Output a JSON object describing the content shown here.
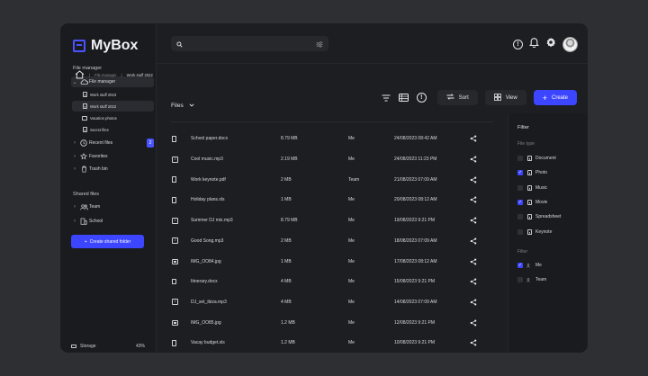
{
  "app": {
    "name": "MyBox"
  },
  "sidebar": {
    "file_manager_title": "File manager",
    "file_manager_label": "File manager",
    "sub_items": [
      {
        "label": "Work stuff 2023"
      },
      {
        "label": "Work stuff 2022"
      },
      {
        "label": "Vacation photos"
      },
      {
        "label": "Secret files"
      }
    ],
    "recent_files_label": "Recent files",
    "recent_files_count": "2",
    "favorites_label": "Favorites",
    "trash_label": "Trash bin",
    "shared_title": "Shared files",
    "shared_items": [
      {
        "label": "Team"
      },
      {
        "label": "School"
      }
    ],
    "create_shared_label": "Create shared folder",
    "storage_label": "Storage",
    "storage_pct": "43%"
  },
  "search": {
    "placeholder": ""
  },
  "breadcrumb": {
    "parent": "File manager",
    "current": "Work stuff 2022"
  },
  "files_heading": "Files",
  "toolbar": {
    "sort_label": "Sort",
    "view_label": "View",
    "create_label": "Create"
  },
  "files": [
    {
      "icon": "doc",
      "name": "School paper.docx",
      "size": "8.79 MB",
      "owner": "Me",
      "date": "24/08/2023 08:42 AM"
    },
    {
      "icon": "music",
      "name": "Cool music.mp3",
      "size": "2.19 MB",
      "owner": "Me",
      "date": "24/08/2023 11:23 PM"
    },
    {
      "icon": "doc",
      "name": "Work keynote.pdf",
      "size": "2 MB",
      "owner": "Team",
      "date": "21/08/2023 07:09 AM"
    },
    {
      "icon": "doc",
      "name": "Holiday plans.xls",
      "size": "1 MB",
      "owner": "Me",
      "date": "20/08/2023 08:12 AM"
    },
    {
      "icon": "music",
      "name": "Summer DJ mix.mp3",
      "size": "8.79 MB",
      "owner": "Me",
      "date": "19/08/2023 9:21 PM"
    },
    {
      "icon": "music",
      "name": "Good Song.mp3",
      "size": "2 MB",
      "owner": "Me",
      "date": "18/08/2023 07:09 AM"
    },
    {
      "icon": "photo",
      "name": "IMG_OO84.jpg",
      "size": "1 MB",
      "owner": "Me",
      "date": "17/08/2023 08:12 AM"
    },
    {
      "icon": "doc",
      "name": "Itinerary.docx",
      "size": "4 MB",
      "owner": "Me",
      "date": "15/08/2023 9:21 PM"
    },
    {
      "icon": "music",
      "name": "DJ_set_ibiza.mp3",
      "size": "4 MB",
      "owner": "Me",
      "date": "14/08/2023 07:09 AM"
    },
    {
      "icon": "photo",
      "name": "IMG_OO85.jpg",
      "size": "1.2 MB",
      "owner": "Me",
      "date": "12/08/2023 9:21 PM"
    },
    {
      "icon": "doc",
      "name": "Vacay budget.xls",
      "size": "1.2 MB",
      "owner": "Me",
      "date": "10/08/2023 9:21 PM"
    }
  ],
  "filter": {
    "title": "Filter",
    "file_type_label": "File type",
    "types": [
      {
        "label": "Document",
        "checked": false
      },
      {
        "label": "Photo",
        "checked": true
      },
      {
        "label": "Music",
        "checked": false
      },
      {
        "label": "Movie",
        "checked": true
      },
      {
        "label": "Spreadsheet",
        "checked": false
      },
      {
        "label": "Keynote",
        "checked": false
      }
    ],
    "owner_label": "Filter",
    "owners": [
      {
        "label": "Me",
        "checked": true
      },
      {
        "label": "Team",
        "checked": false
      }
    ]
  },
  "colors": {
    "accent": "#3c45ff",
    "background": "#1d1e21",
    "sidebar": "#1a1b1e"
  }
}
